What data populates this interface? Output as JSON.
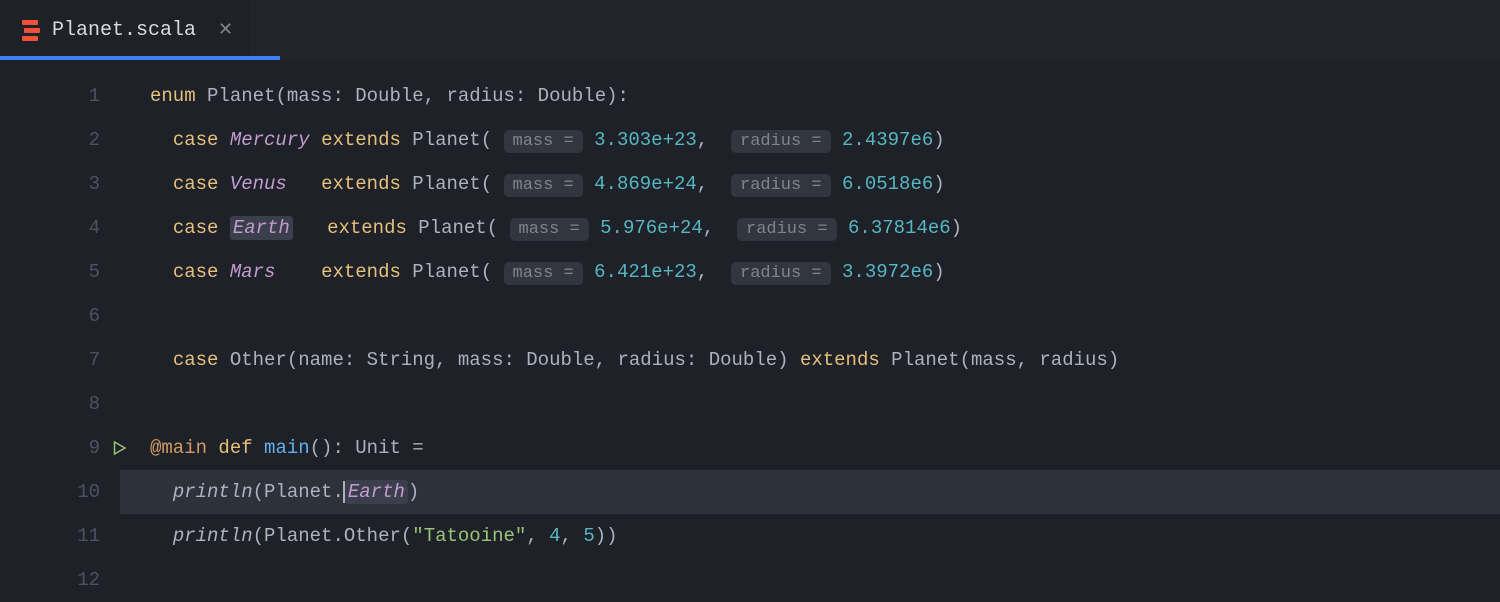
{
  "tab": {
    "title": "Planet.scala",
    "icon": "scala-icon"
  },
  "gutter": {
    "lines": [
      "1",
      "2",
      "3",
      "4",
      "5",
      "6",
      "7",
      "8",
      "9",
      "10",
      "11",
      "12"
    ],
    "run_line": 9
  },
  "code": {
    "kw_enum": "enum",
    "kw_case": "case",
    "kw_extends": "extends",
    "kw_def": "def",
    "kw_main_ann": "@main",
    "planet": "Planet",
    "params_sig": "(mass: Double, radius: Double):",
    "cases": [
      {
        "name": "Mercury",
        "pad": "",
        "mass": "3.303e+23",
        "radius": "2.4397e6"
      },
      {
        "name": "Venus",
        "pad": "  ",
        "mass": "4.869e+24",
        "radius": "6.0518e6"
      },
      {
        "name": "Earth",
        "pad": "  ",
        "mass": "5.976e+24",
        "radius": "6.37814e6"
      },
      {
        "name": "Mars",
        "pad": "   ",
        "mass": "6.421e+23",
        "radius": "3.3972e6"
      }
    ],
    "hint_mass": "mass =",
    "hint_radius": "radius =",
    "other_line_name": "Other",
    "other_line_sig": "(name: String, mass: Double, radius: Double)",
    "other_extends_args": "(mass, radius)",
    "main_fn": "main",
    "main_sig": "(): Unit =",
    "println": "println",
    "earth_ref": "Earth",
    "other_ref": "Other",
    "tatooine": "\"Tatooine\"",
    "num4": "4",
    "num5": "5"
  }
}
